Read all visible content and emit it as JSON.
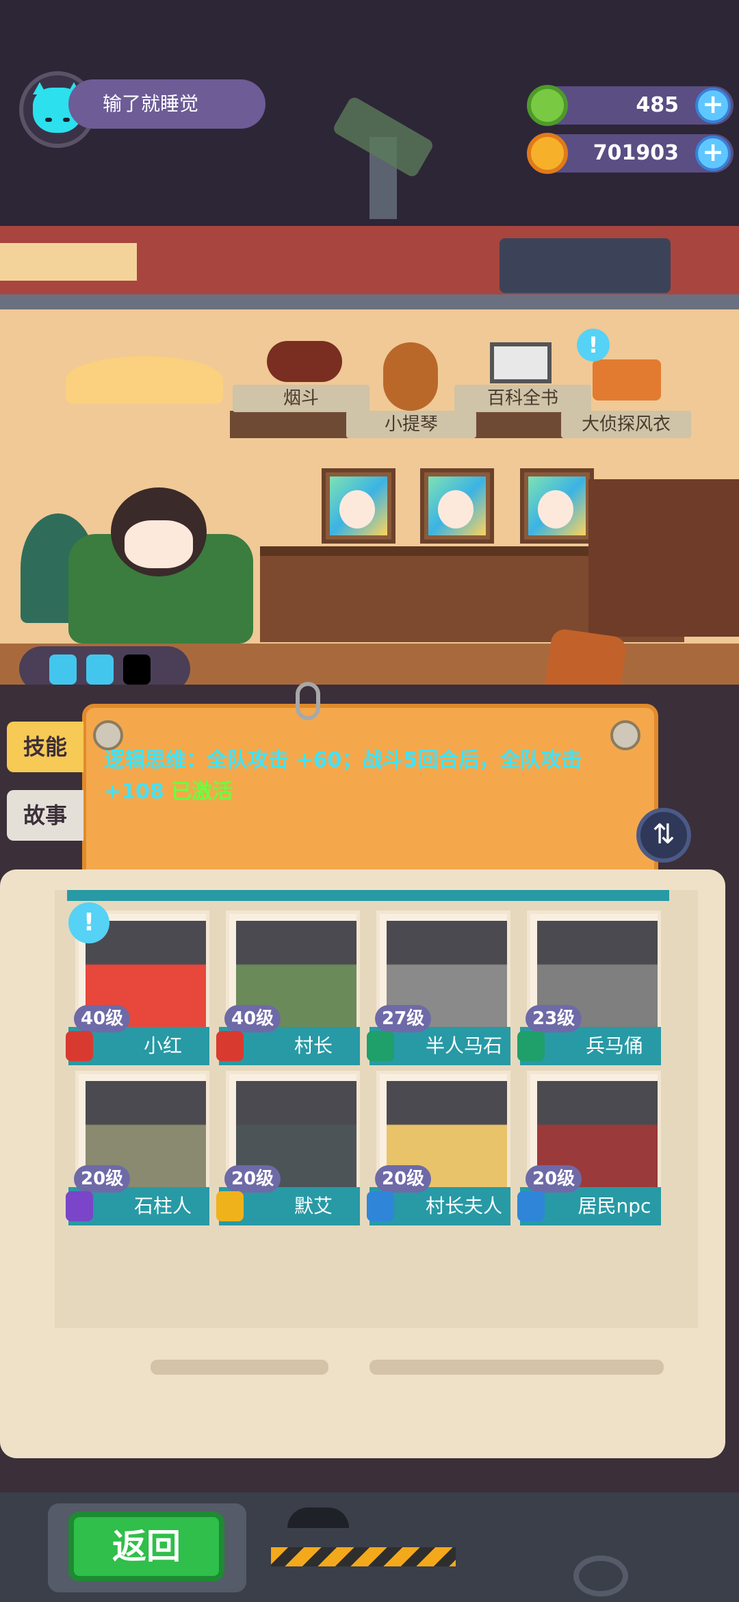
{
  "player": {
    "name": "输了就睡觉"
  },
  "currency": {
    "gems": "485",
    "coins": "701903"
  },
  "shelf": {
    "items": [
      "烟斗",
      "小提琴",
      "百科全书",
      "大侦探风衣"
    ]
  },
  "skill_text": {
    "main": "逻辑思维：全队攻击 +60；战斗5回合后，全队攻击 +108",
    "status": "已激活"
  },
  "tabs": [
    {
      "label": "技能"
    },
    {
      "label": "故事"
    }
  ],
  "characters": [
    {
      "level": "40级",
      "name": "小红",
      "badge_color": "#d93a2f"
    },
    {
      "level": "40级",
      "name": "村长",
      "badge_color": "#d93a2f"
    },
    {
      "level": "27级",
      "name": "半人马石像",
      "badge_color": "#1f9f6a"
    },
    {
      "level": "23级",
      "name": "兵马俑",
      "badge_color": "#1f9f6a"
    },
    {
      "level": "20级",
      "name": "石柱人",
      "badge_color": "#7a45c8"
    },
    {
      "level": "20级",
      "name": "默艾",
      "badge_color": "#f0b21a"
    },
    {
      "level": "20级",
      "name": "村长夫人",
      "badge_color": "#2f86d9"
    },
    {
      "level": "20级",
      "name": "居民npc",
      "badge_color": "#2f86d9"
    }
  ],
  "back_button": {
    "label": "返回"
  },
  "colors": {
    "accent": "#f4a84b",
    "panel_teal": "#279aa5"
  }
}
